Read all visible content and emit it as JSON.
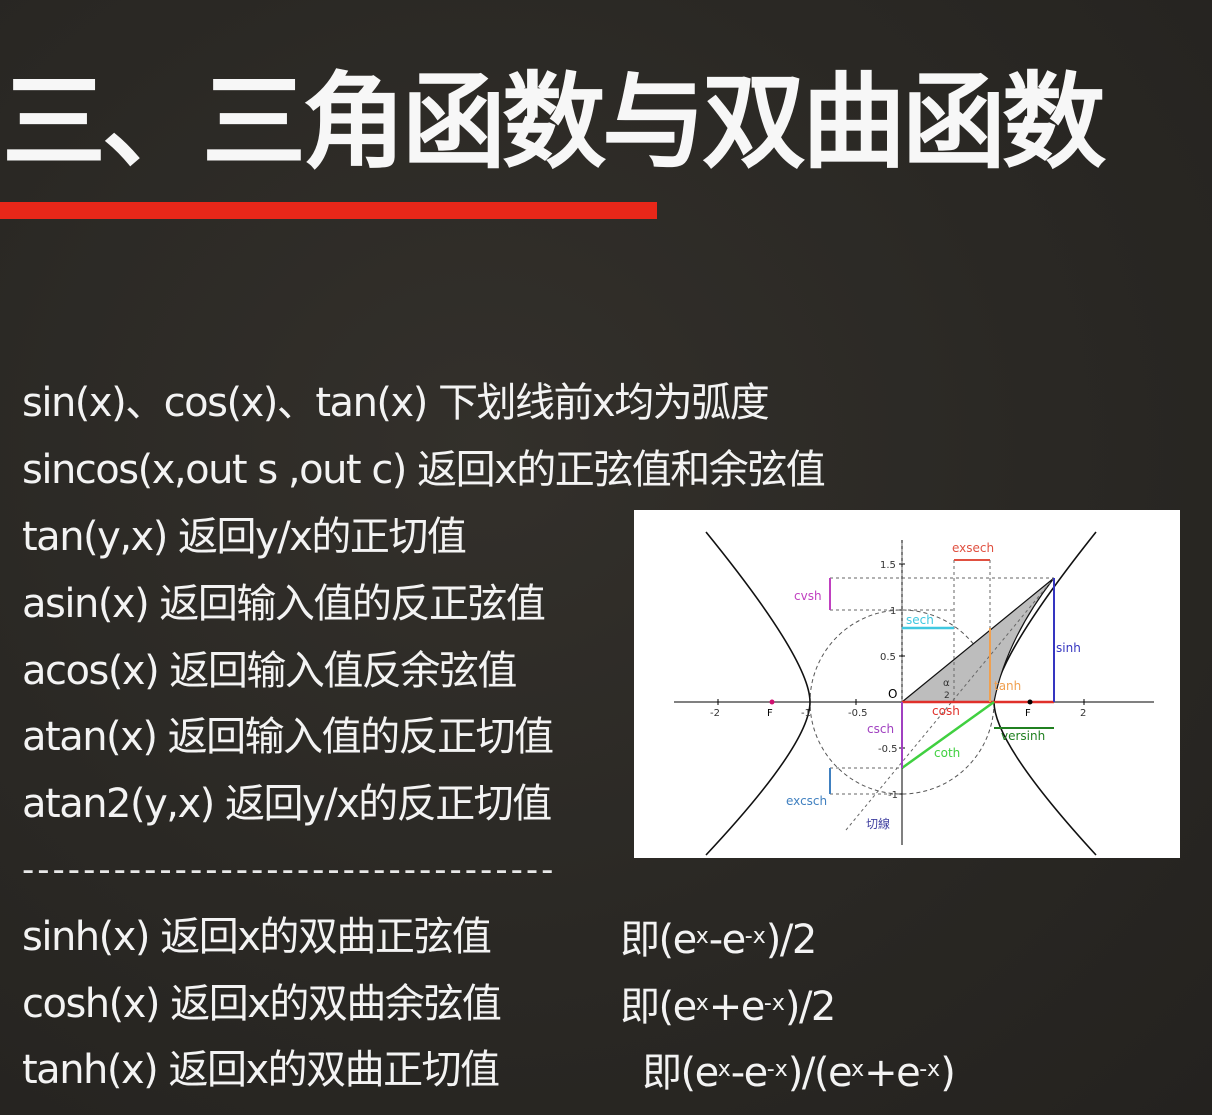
{
  "title": "三、三角函数与双曲函数",
  "accent_color": "#e82719",
  "lines": [
    "sin(x)、cos(x)、tan(x) 下划线前x均为弧度",
    "sincos(x,out s ,out c) 返回x的正弦值和余弦值",
    "tan(y,x) 返回y/x的正切值",
    "asin(x) 返回输入值的反正弦值",
    "acos(x) 返回输入值反余弦值",
    "atan(x) 返回输入值的反正切值",
    "atan2(y,x) 返回y/x的反正切值"
  ],
  "divider": "-----------------------------------",
  "hyperbolic": [
    {
      "desc": "sinh(x) 返回x的双曲正弦值",
      "f_prefix": "即(e",
      "f_sup1": "x",
      "f_mid": "-e",
      "f_sup2": "-x",
      "f_suffix": ")/2"
    },
    {
      "desc": "cosh(x) 返回x的双曲余弦值",
      "f_prefix": "即(e",
      "f_sup1": "x",
      "f_mid": "+e",
      "f_sup2": "-x",
      "f_suffix": ")/2"
    },
    {
      "desc": "tanh(x) 返回x的双曲正切值",
      "f_prefix": "即(e",
      "f_sup1": "x",
      "f_mid": "-e",
      "f_sup2": "-x",
      "f_mid2": ")/(e",
      "f_sup3": "x",
      "f_mid3": "+e",
      "f_sup4": "-x",
      "f_suffix": ")"
    }
  ],
  "figure": {
    "labels": {
      "exsech": "exsech",
      "cvsh": "cvsh",
      "sech": "sech",
      "sinh": "sinh",
      "tanh": "tanh",
      "cosh": "cosh",
      "csch": "csch",
      "coth": "coth",
      "versinh": "versinh",
      "excsch": "excsch",
      "tangent": "切線",
      "alpha": "α",
      "half": "2",
      "origin": "O",
      "focus": "F"
    },
    "ticks": {
      "x_m2": "-2",
      "x_m1": "-1",
      "x_m05": "-0.5",
      "x_2": "2",
      "y_15": "1.5",
      "y_1": "1",
      "y_05": "0.5",
      "y_m05": "-0.5",
      "y_m1": "-1"
    },
    "colors": {
      "sinh": "#3535c0",
      "cosh": "#e0302a",
      "tanh": "#f0a050",
      "sech": "#40c8e0",
      "coth": "#40d040",
      "csch": "#a040c0",
      "cvsh": "#c040c0",
      "versinh": "#208020",
      "exsech": "#e05040",
      "excsch": "#4080c0"
    }
  }
}
